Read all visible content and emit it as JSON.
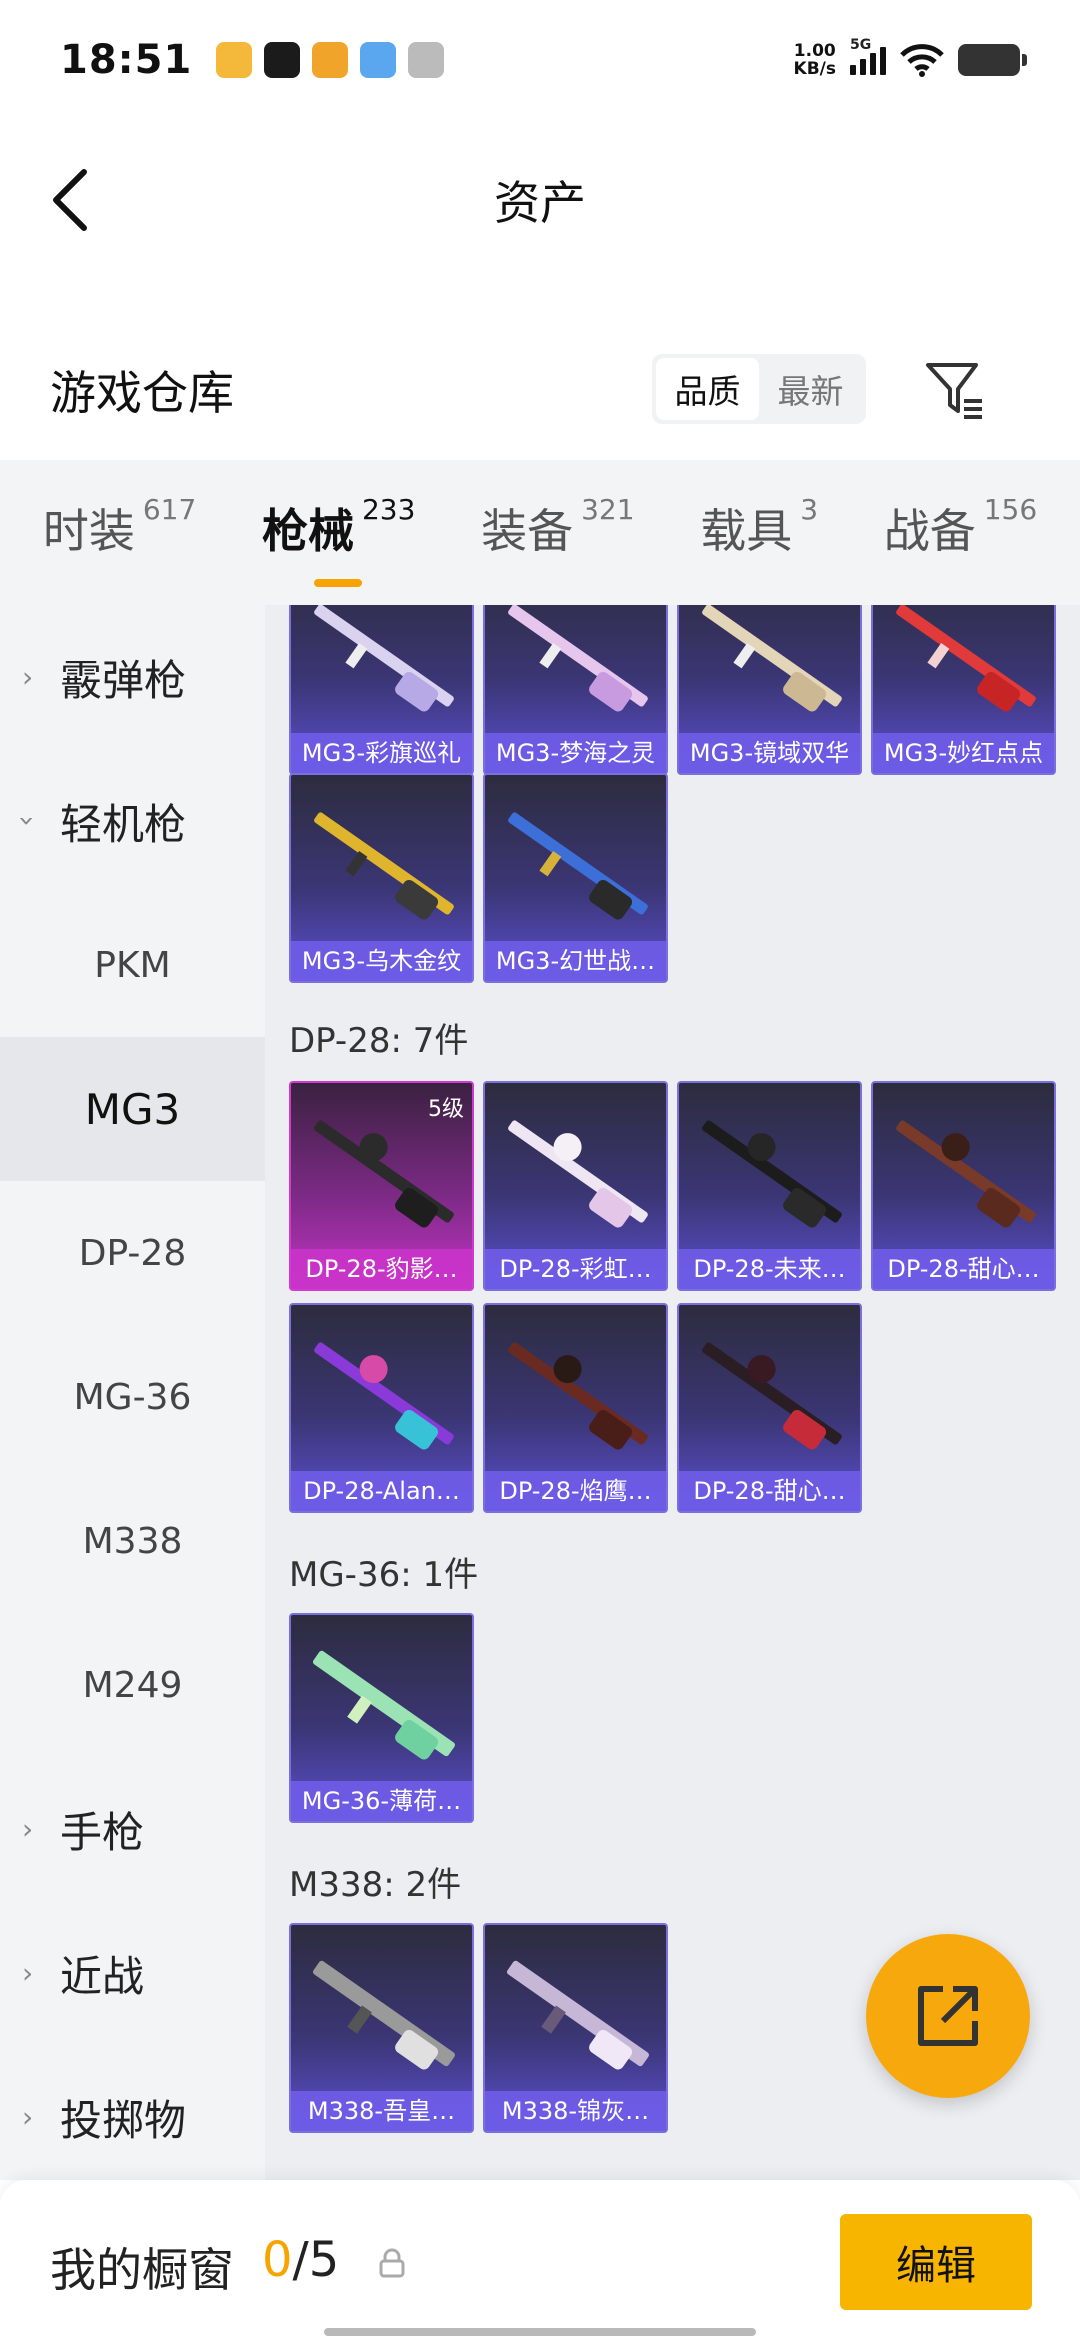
{
  "status": {
    "time": "18:51",
    "net_speed_value": "1.00",
    "net_speed_unit": "KB/s",
    "network": "5G"
  },
  "header": {
    "title": "资产",
    "back_icon": "back-arrow-icon"
  },
  "warehouse": {
    "title": "游戏仓库",
    "sort_options": [
      "品质",
      "最新"
    ],
    "active_sort": "品质",
    "filter_icon": "filter-icon"
  },
  "tabs": [
    {
      "label": "时装",
      "count": "617"
    },
    {
      "label": "枪械",
      "count": "233",
      "active": true
    },
    {
      "label": "装备",
      "count": "321"
    },
    {
      "label": "载具",
      "count": "3"
    },
    {
      "label": "战备",
      "count": "156"
    }
  ],
  "sidebar": [
    {
      "label": "霰弹枪",
      "type": "parent",
      "expanded": false
    },
    {
      "label": "轻机枪",
      "type": "parent",
      "expanded": true
    },
    {
      "label": "PKM",
      "type": "child"
    },
    {
      "label": "MG3",
      "type": "child",
      "selected": true
    },
    {
      "label": "DP-28",
      "type": "child"
    },
    {
      "label": "MG-36",
      "type": "child"
    },
    {
      "label": "M338",
      "type": "child"
    },
    {
      "label": "M249",
      "type": "child"
    },
    {
      "label": "手枪",
      "type": "parent",
      "expanded": false
    },
    {
      "label": "近战",
      "type": "parent",
      "expanded": false
    },
    {
      "label": "投掷物",
      "type": "parent",
      "expanded": false
    }
  ],
  "groups": {
    "mg3": {
      "items": [
        {
          "name": "MG3-彩旗巡礼"
        },
        {
          "name": "MG3-梦海之灵"
        },
        {
          "name": "MG3-镜域双华"
        },
        {
          "name": "MG3-妙红点点"
        },
        {
          "name": "MG3-乌木金纹"
        },
        {
          "name": "MG3-幻世战…"
        }
      ]
    },
    "dp28": {
      "label": "DP-28: 7件",
      "items": [
        {
          "name": "DP-28-豹影…",
          "level": "5级"
        },
        {
          "name": "DP-28-彩虹…"
        },
        {
          "name": "DP-28-未来…"
        },
        {
          "name": "DP-28-甜心…"
        },
        {
          "name": "DP-28-Alan…"
        },
        {
          "name": "DP-28-焰鹰…"
        },
        {
          "name": "DP-28-甜心…"
        }
      ]
    },
    "mg36": {
      "label": "MG-36: 1件",
      "items": [
        {
          "name": "MG-36-薄荷…"
        }
      ]
    },
    "m338": {
      "label": "M338: 2件",
      "items": [
        {
          "name": "M338-吾皇…"
        },
        {
          "name": "M338-锦灰…"
        }
      ]
    }
  },
  "fab": {
    "icon": "share-external-icon"
  },
  "bottom": {
    "label": "我的橱窗",
    "current": "0",
    "separator": "/",
    "max": "5",
    "edit_label": "编辑",
    "lock_icon": "lock-icon"
  },
  "colors": {
    "accent": "#f7a400",
    "card_purple": "#5b4fcf",
    "card_legend": "#c234c4"
  }
}
